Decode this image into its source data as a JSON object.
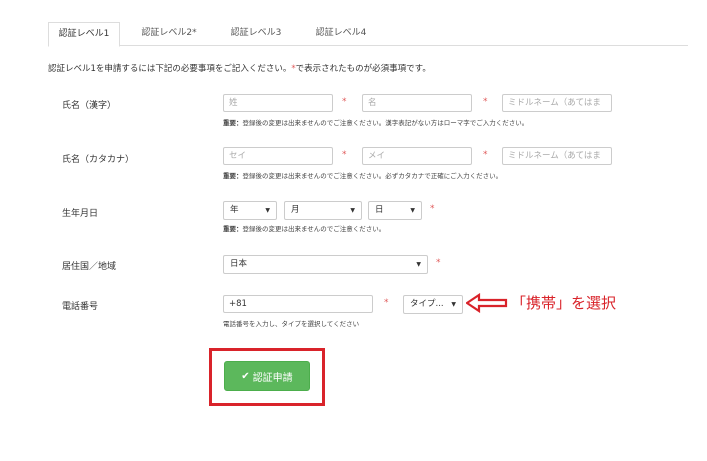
{
  "tabs": [
    {
      "label": "認証レベル1"
    },
    {
      "label": "認証レベル2*"
    },
    {
      "label": "認証レベル3"
    },
    {
      "label": "認証レベル4"
    }
  ],
  "intro": {
    "text1": "認証レベル1を申請するには下記の必要事項をご記入ください。",
    "star": "*",
    "text2": "で表示されたものが必須事項です。"
  },
  "form": {
    "kanji_name": {
      "label": "氏名（漢字）",
      "last_placeholder": "姓",
      "first_placeholder": "名",
      "middle_placeholder": "ミドルネーム（あてはま",
      "note_bold": "重要：",
      "note": "登録後の変更は出来ませんのでご注意ください。漢字表記がない方はローマ字でご入力ください。"
    },
    "kana_name": {
      "label": "氏名（カタカナ）",
      "last_placeholder": "セイ",
      "first_placeholder": "メイ",
      "middle_placeholder": "ミドルネーム（あてはま",
      "note_bold": "重要：",
      "note": "登録後の変更は出来ませんのでご注意ください。必ずカタカナで正確にご入力ください。"
    },
    "birthdate": {
      "label": "生年月日",
      "year": "年",
      "month": "月",
      "day": "日",
      "note_bold": "重要：",
      "note": "登録後の変更は出来ませんのでご注意ください。"
    },
    "country": {
      "label": "居住国／地域",
      "value": "日本"
    },
    "phone": {
      "label": "電話番号",
      "value": "+81",
      "type_value": "タイプ...",
      "help": "電話番号を入力し、タイプを選択してください"
    },
    "required_mark": "*"
  },
  "annotation": {
    "text": "「携帯」を選択",
    "color": "#d9232a"
  },
  "submit": {
    "label": "認証申請",
    "color": "#5cb85c"
  }
}
